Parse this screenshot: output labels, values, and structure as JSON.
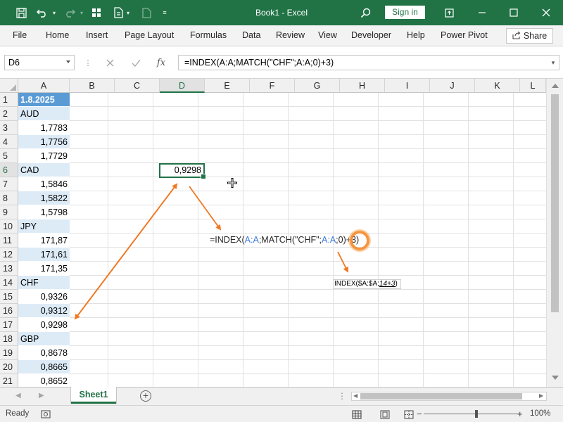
{
  "app": {
    "title": "Book1  -  Excel",
    "sign_in": "Sign in",
    "brand_color": "#217346"
  },
  "quick_access": {
    "icons": [
      "save-icon",
      "undo-icon",
      "redo-icon",
      "layout-icon",
      "new-doc-icon",
      "doc-icon",
      "customize-icon"
    ]
  },
  "window_controls": [
    "search-icon",
    "ribbon-display-icon",
    "minimize-icon",
    "maximize-icon",
    "close-icon"
  ],
  "ribbon": {
    "tabs": [
      "File",
      "Home",
      "Insert",
      "Page Layout",
      "Formulas",
      "Data",
      "Review",
      "View",
      "Developer",
      "Help",
      "Power Pivot"
    ],
    "share": "Share"
  },
  "formula_bar": {
    "name_box": "D6",
    "fx": "fx",
    "formula": "=INDEX(A:A;MATCH(\"CHF\";A:A;0)+3)"
  },
  "grid": {
    "columns": [
      "A",
      "B",
      "C",
      "D",
      "E",
      "F",
      "G",
      "H",
      "I",
      "J",
      "K",
      "L"
    ],
    "selected_column": "D",
    "rows": [
      "1",
      "2",
      "3",
      "4",
      "5",
      "6",
      "7",
      "8",
      "9",
      "10",
      "11",
      "12",
      "13",
      "14",
      "15",
      "16",
      "17",
      "18",
      "19",
      "20",
      "21"
    ],
    "selected_row": "6",
    "column_a": [
      {
        "value": "1.8.2025",
        "kind": "header"
      },
      {
        "value": "AUD",
        "kind": "label"
      },
      {
        "value": "1,7783",
        "kind": "num"
      },
      {
        "value": "1,7756",
        "kind": "num"
      },
      {
        "value": "1,7729",
        "kind": "num"
      },
      {
        "value": "CAD",
        "kind": "label"
      },
      {
        "value": "1,5846",
        "kind": "num"
      },
      {
        "value": "1,5822",
        "kind": "num"
      },
      {
        "value": "1,5798",
        "kind": "num"
      },
      {
        "value": "JPY",
        "kind": "label"
      },
      {
        "value": "171,87",
        "kind": "num"
      },
      {
        "value": "171,61",
        "kind": "num"
      },
      {
        "value": "171,35",
        "kind": "num"
      },
      {
        "value": "CHF",
        "kind": "label"
      },
      {
        "value": "0,9326",
        "kind": "num"
      },
      {
        "value": "0,9312",
        "kind": "num"
      },
      {
        "value": "0,9298",
        "kind": "num"
      },
      {
        "value": "GBP",
        "kind": "label"
      },
      {
        "value": "0,8678",
        "kind": "num"
      },
      {
        "value": "0,8665",
        "kind": "num"
      },
      {
        "value": "0,8652",
        "kind": "num"
      }
    ],
    "active_cell_value": "0,9298"
  },
  "annotation": {
    "formula_parts": [
      "=INDEX(",
      "A:A",
      ";MATCH(\"CHF\";",
      "A:A",
      ";0)",
      "+3)"
    ],
    "tip_prefix": "INDEX($A:$A;",
    "tip_underlined": "14+3",
    "tip_suffix": ")",
    "arrow_color": "#f07820"
  },
  "sheets": {
    "active": "Sheet1"
  },
  "status_bar": {
    "ready": "Ready",
    "zoom": "100%"
  }
}
